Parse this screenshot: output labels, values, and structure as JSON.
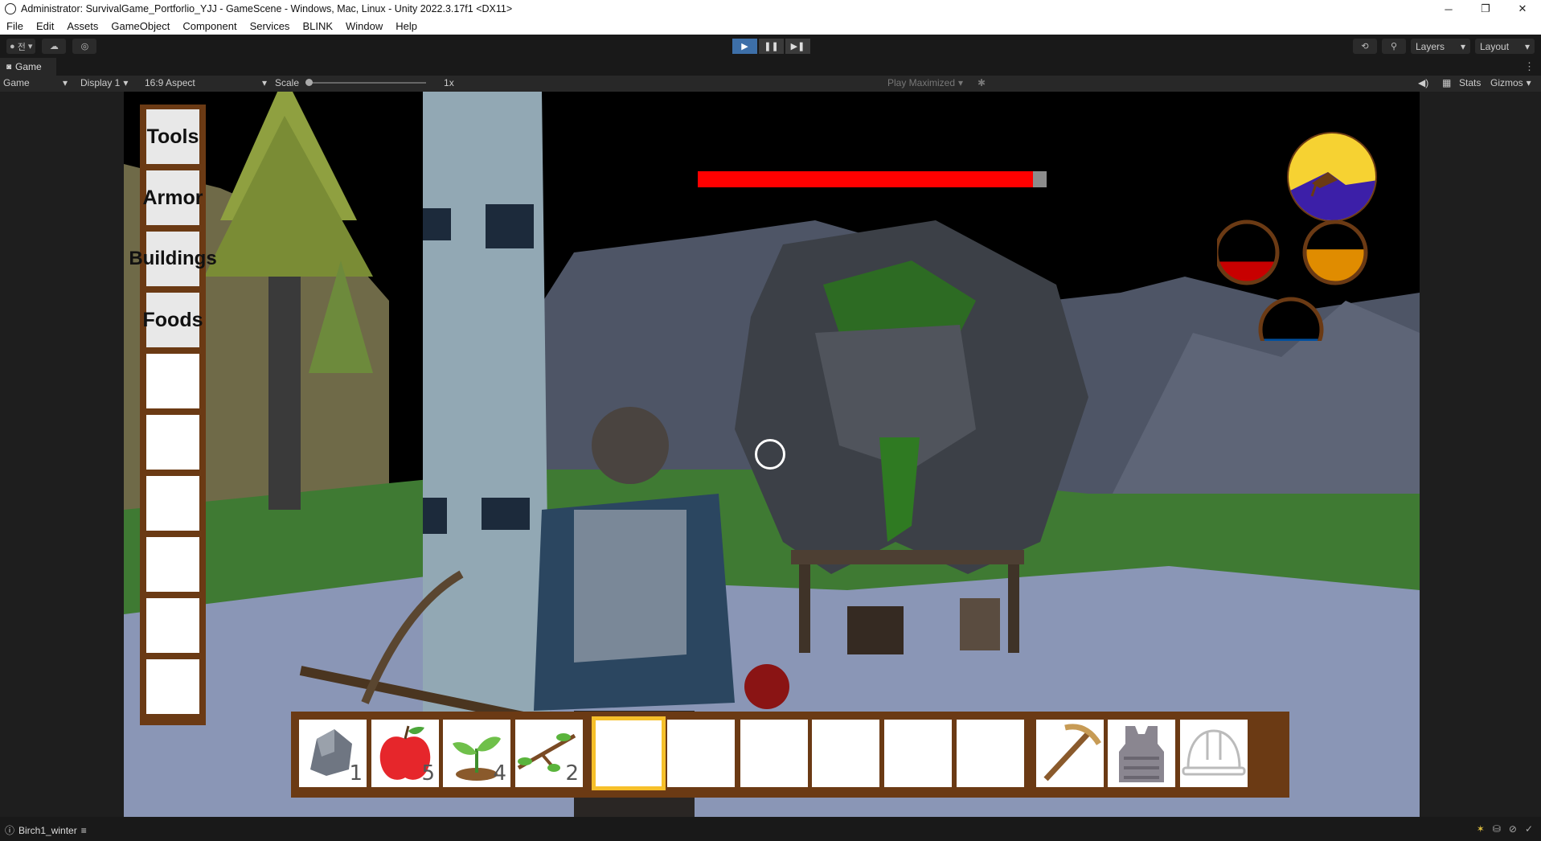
{
  "window": {
    "title": "Administrator: SurvivalGame_Portforlio_YJJ - GameScene - Windows, Mac, Linux - Unity 2022.3.17f1 <DX11>",
    "controls": [
      "─",
      "❐",
      "✕"
    ]
  },
  "menu": [
    "File",
    "Edit",
    "Assets",
    "GameObject",
    "Component",
    "Services",
    "BLINK",
    "Window",
    "Help"
  ],
  "toolbar": {
    "account_label": "전",
    "play": "▶",
    "pause": "❚❚",
    "step": "▶❚",
    "layers": "Layers",
    "layout": "Layout"
  },
  "tab": {
    "label": "Game"
  },
  "game_toolbar": {
    "mode": "Game",
    "display": "Display 1",
    "aspect": "16:9 Aspect",
    "scale_label": "Scale",
    "scale_value": "1x",
    "scale_level": 0.0,
    "play_mode": "Play Maximized",
    "stats": "Stats",
    "gizmos": "Gizmos"
  },
  "hud": {
    "categories": [
      "Tools",
      "Armor",
      "Buildings",
      "Foods",
      "",
      "",
      "",
      "",
      "",
      ""
    ],
    "enemy_health": 0.96,
    "day_cycle": "sun-over-mountain-icon",
    "stats": [
      {
        "name": "health",
        "level": 0.35,
        "color": "#c80000"
      },
      {
        "name": "hunger",
        "level": 0.55,
        "color": "#e08c00"
      },
      {
        "name": "thirst",
        "level": 0.35,
        "color": "#004f9e"
      }
    ],
    "hotbar": [
      {
        "icon": "stone-icon",
        "count": "1"
      },
      {
        "icon": "apple-icon",
        "count": "5"
      },
      {
        "icon": "sapling-icon",
        "count": "4"
      },
      {
        "icon": "branch-icon",
        "count": "2"
      },
      {
        "icon": "",
        "count": "",
        "selected": true
      },
      {
        "icon": "",
        "count": ""
      },
      {
        "icon": "",
        "count": ""
      },
      {
        "icon": "",
        "count": ""
      },
      {
        "icon": "",
        "count": ""
      },
      {
        "icon": "",
        "count": ""
      },
      {
        "icon": "pickaxe-icon",
        "count": ""
      },
      {
        "icon": "armor-vest-icon",
        "count": ""
      },
      {
        "icon": "helmet-icon",
        "count": ""
      }
    ]
  },
  "status": {
    "message": "Birch1_winter"
  },
  "colors": {
    "accent": "#3d6fa8",
    "panel": "#6b3a14",
    "select": "#f6c02a"
  }
}
